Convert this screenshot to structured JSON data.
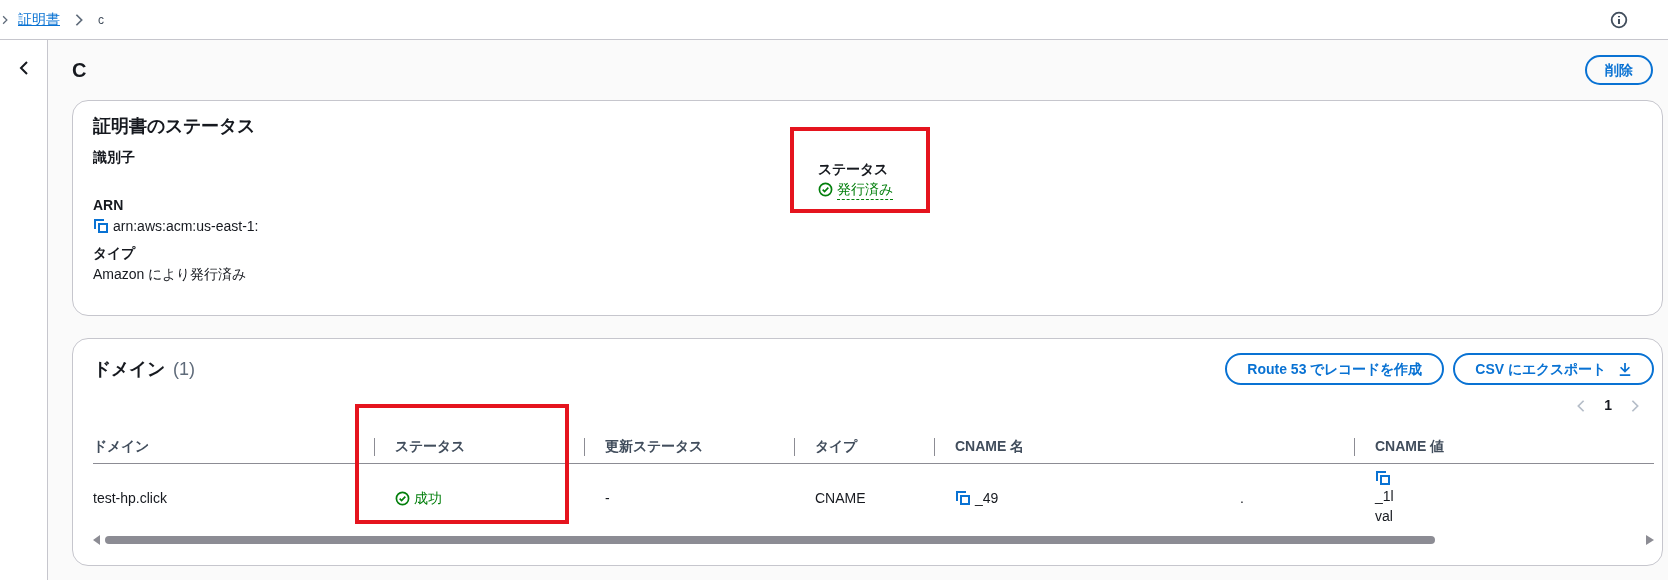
{
  "breadcrumb": [
    {
      "label": "証明書",
      "kind": "link"
    },
    {
      "label": "c",
      "kind": "current"
    }
  ],
  "page_title": "C",
  "delete_button": "削除",
  "status_card": {
    "title": "証明書のステータス",
    "left_fields": [
      {
        "label": "識別子",
        "kind": "blank"
      },
      {
        "label": "ARN",
        "kind": "copy",
        "value": "arn:aws:acm:us-east-1:"
      },
      {
        "label": "タイプ",
        "kind": "text",
        "value": "Amazon により発行済み"
      }
    ],
    "right_fields": [
      {
        "label": "ステータス",
        "kind": "status",
        "value": "発行済み",
        "highlighted": true
      }
    ]
  },
  "domains": {
    "title": "ドメイン",
    "count": "(1)",
    "buttons": [
      {
        "label": "Route 53 でレコードを作成",
        "kind": "plain"
      },
      {
        "label": "CSV にエクスポート",
        "kind": "download"
      }
    ],
    "page": "1",
    "columns": [
      {
        "label": "ドメイン",
        "highlighted": false
      },
      {
        "label": "ステータス",
        "highlighted": true
      },
      {
        "label": "更新ステータス",
        "highlighted": false
      },
      {
        "label": "タイプ",
        "highlighted": false
      },
      {
        "label": "CNAME 名",
        "highlighted": false
      },
      {
        "label": "CNAME 値",
        "highlighted": false
      }
    ],
    "rows": [
      {
        "cells": [
          {
            "kind": "text",
            "texts": [
              "test-hp.click"
            ]
          },
          {
            "kind": "status",
            "texts": [
              "成功"
            ]
          },
          {
            "kind": "text",
            "texts": [
              "-"
            ]
          },
          {
            "kind": "text",
            "texts": [
              "CNAME"
            ]
          },
          {
            "kind": "copy",
            "texts": [
              "_49",
              "."
            ]
          },
          {
            "kind": "copy_stacked",
            "texts": [
              "_1l",
              "val"
            ]
          }
        ]
      }
    ]
  }
}
